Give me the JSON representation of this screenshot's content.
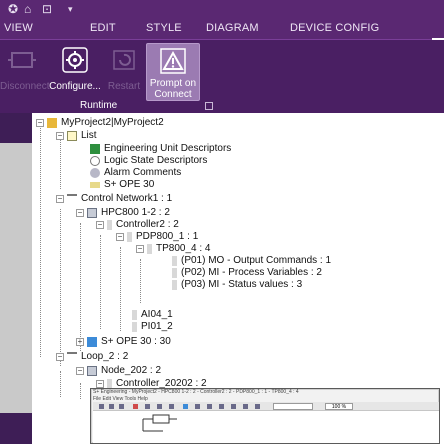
{
  "quick_access": {
    "icons": [
      "app-icon",
      "home-icon",
      "open-icon",
      "customize-dropdown-icon"
    ]
  },
  "menu": {
    "items": [
      "VIEW",
      "EDIT",
      "STYLE",
      "DIAGRAM",
      "DEVICE CONFIG"
    ]
  },
  "ribbon": {
    "buttons": [
      {
        "label_lines": [
          "Disconnect"
        ],
        "enabled": false,
        "icon": "disconnect-icon"
      },
      {
        "label_lines": [
          "Configure..."
        ],
        "enabled": true,
        "icon": "configure-gear-icon"
      },
      {
        "label_lines": [
          "Restart"
        ],
        "enabled": false,
        "icon": "restart-icon"
      },
      {
        "label_lines": [
          "Prompt on",
          "Connect"
        ],
        "enabled": true,
        "active": true,
        "icon": "warning-icon"
      }
    ],
    "group_label": "Runtime"
  },
  "tree": {
    "root": "MyProject2|MyProject2",
    "list": "List",
    "eud": "Engineering Unit Descriptors",
    "lsd": "Logic State Descriptors",
    "alarm": "Alarm Comments",
    "ope_list": "S+ OPE 30",
    "cn1": "Control Network1 : 1",
    "hpc": "HPC800 1-2 : 2",
    "ctrl2": "Controller2 : 2",
    "pdp": "PDP800_1 : 1",
    "tp": "TP800_4 : 4",
    "p01": "(P01) MO - Output Commands : 1",
    "p02": "(P02) MI - Process Variables : 2",
    "p03": "(P03) MI - Status values : 3",
    "ai": "AI04_1",
    "pi": "PI01_2",
    "ope30": "S+ OPE 30 : 30",
    "loop": "Loop_2 : 2",
    "node": "Node_202 : 2",
    "ctrl20202": "Controller_20202 : 2"
  },
  "inset": {
    "title": "S+ Engineering - MyProject2 - HPC800 1-2 : 2 - Controller2 : 2 - PDP800_1 : 1 - TP800_4 : 4",
    "menu": "File   Edit   View   Tools   Help",
    "zoom_value": "100 %"
  },
  "colors": {
    "menubar": "#5a2872",
    "ribbon": "#4a1f63",
    "active_button": "#9b7bb2"
  }
}
